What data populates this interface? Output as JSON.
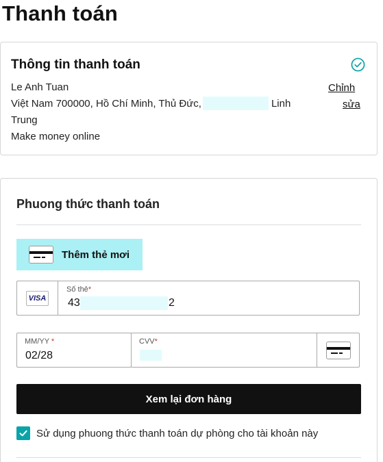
{
  "page": {
    "title": "Thanh toán"
  },
  "billing_info": {
    "heading": "Thông tin thanh toán",
    "status_icon": "check-circle-icon",
    "name": "Le Anh Tuan",
    "address_part1": "Việt Nam 700000, Hồ Chí Minh, Thủ Đức,",
    "address_part2": "Linh",
    "address_part3": "Trung",
    "note": "Make money online",
    "edit_label_line1": "Chỉnh",
    "edit_label_line2": "sửa"
  },
  "payment_method": {
    "heading": "Phuong thức thanh toán",
    "add_card_label": "Thêm thẻ mơi",
    "card_number": {
      "label": "Số thẻ",
      "required_mark": "*",
      "brand": "VISA",
      "value_prefix": "43(",
      "value_suffix": "2"
    },
    "expiry": {
      "label": "MM/YY",
      "required_mark": "*",
      "value": "02/28"
    },
    "cvv": {
      "label": "CVV",
      "required_mark": "*"
    },
    "review_button_label": "Xem lại đơn hàng",
    "backup_checkbox": {
      "checked": true,
      "label": "Sử dụng phuong thức thanh toán dự phòng cho tài khoản này"
    }
  },
  "colors": {
    "accent_teal": "#0aa4a8",
    "add_card_bg": "#aaf0f4",
    "primary_button": "#111111",
    "required": "#c0392b"
  }
}
